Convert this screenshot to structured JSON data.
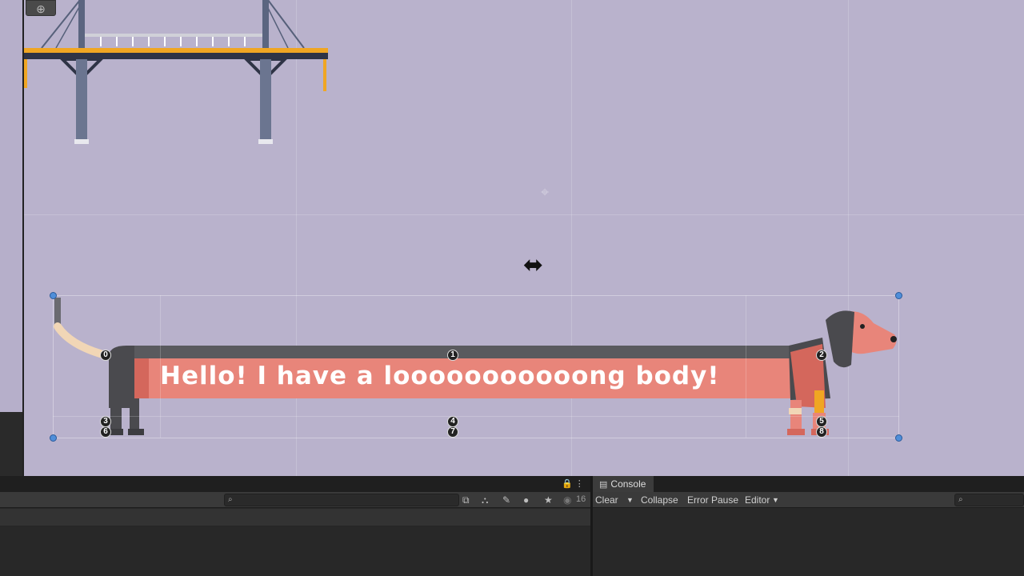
{
  "scene": {
    "dog_text": "Hello! I have a looooooooooong body!",
    "bone_numbers": [
      "0",
      "1",
      "2",
      "3",
      "4",
      "5",
      "6",
      "7",
      "8"
    ],
    "gizmo_icon": "move-gizmo-icon"
  },
  "project_panel": {
    "search_placeholder": "",
    "hidden_count": "16"
  },
  "console": {
    "tab_label": "Console",
    "clear_label": "Clear",
    "collapse_label": "Collapse",
    "error_pause_label": "Error Pause",
    "editor_label": "Editor",
    "search_placeholder": ""
  },
  "colors": {
    "scene_bg": "#b9b2cc",
    "dog_body": "#e8857a",
    "dog_dark": "#4a4a4e",
    "bridge_orange": "#f0a623",
    "handle_blue": "#4f8ed9"
  }
}
